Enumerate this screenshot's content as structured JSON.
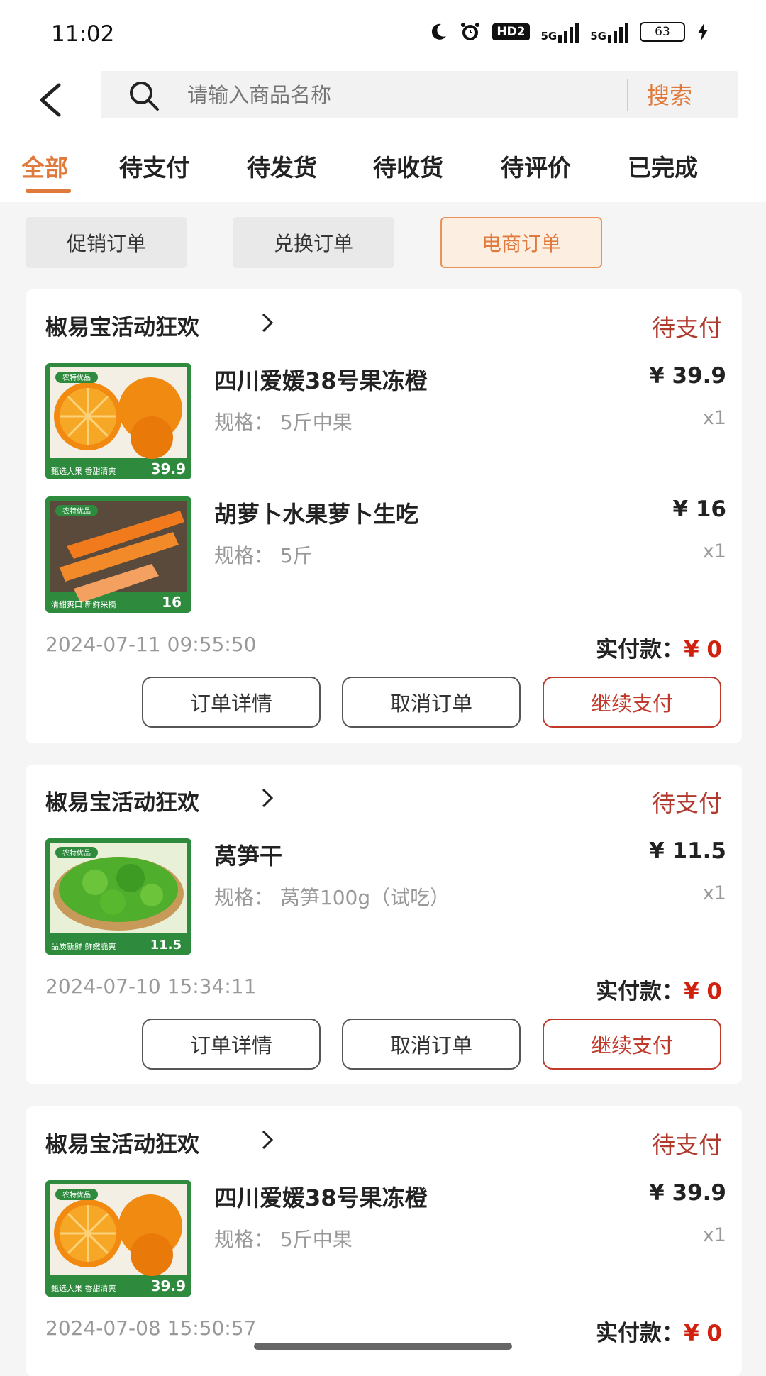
{
  "status_bar": {
    "time": "11:02",
    "battery": "63",
    "hd_label": "HD2",
    "net1": "5G",
    "net2": "5G"
  },
  "header": {
    "search_placeholder": "请输入商品名称",
    "search_button": "搜索"
  },
  "tabs": [
    {
      "label": "全部",
      "active": true
    },
    {
      "label": "待支付"
    },
    {
      "label": "待发货"
    },
    {
      "label": "待收货"
    },
    {
      "label": "待评价"
    },
    {
      "label": "已完成"
    }
  ],
  "subtabs": [
    {
      "label": "促销订单"
    },
    {
      "label": "兑换订单"
    },
    {
      "label": "电商订单",
      "active": true
    }
  ],
  "orders": [
    {
      "shop": "椒易宝活动狂欢",
      "status": "待支付",
      "items": [
        {
          "title": "四川爱媛38号果冻橙",
          "spec": "规格：  5斤中果",
          "price": "¥ 39.9",
          "qty": "x1",
          "thumb_icon": "orange-product-image",
          "badge_price": "39.9",
          "badge_text": "甄选大果 香甜清爽"
        },
        {
          "title": "胡萝卜水果萝卜生吃",
          "spec": "规格：  5斤",
          "price": "¥ 16",
          "qty": "x1",
          "thumb_icon": "carrot-product-image",
          "badge_price": "16",
          "badge_text": "清甜爽口 新鲜采摘"
        }
      ],
      "time": "2024-07-11 09:55:50",
      "paid_label": "实付款：",
      "paid_amount": "¥ 0",
      "buttons": {
        "detail": "订单详情",
        "cancel": "取消订单",
        "pay": "继续支付"
      }
    },
    {
      "shop": "椒易宝活动狂欢",
      "status": "待支付",
      "items": [
        {
          "title": "莴笋干",
          "spec": "规格：  莴笋100g（试吃）",
          "price": "¥ 11.5",
          "qty": "x1",
          "thumb_icon": "lettuce-product-image",
          "badge_price": "11.5",
          "badge_text": "品质新鲜 鲜嫩脆爽"
        }
      ],
      "time": "2024-07-10 15:34:11",
      "paid_label": "实付款：",
      "paid_amount": "¥ 0",
      "buttons": {
        "detail": "订单详情",
        "cancel": "取消订单",
        "pay": "继续支付"
      }
    },
    {
      "shop": "椒易宝活动狂欢",
      "status": "待支付",
      "items": [
        {
          "title": "四川爱媛38号果冻橙",
          "spec": "规格：  5斤中果",
          "price": "¥ 39.9",
          "qty": "x1",
          "thumb_icon": "orange-product-image",
          "badge_price": "39.9",
          "badge_text": "甄选大果 香甜清爽"
        }
      ],
      "time": "2024-07-08 15:50:57",
      "paid_label": "实付款：",
      "paid_amount": "¥ 0"
    }
  ],
  "colors": {
    "accent": "#e07a3c",
    "status_red": "#b03a2e",
    "price_red": "#d0210e",
    "thumb_green": "#2e8b3e"
  },
  "thumb_brand": "农特优品"
}
